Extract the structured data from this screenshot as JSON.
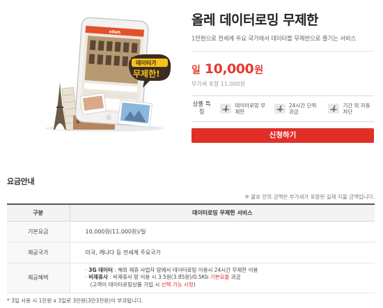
{
  "product": {
    "title": "올레 데이터로밍 무제한",
    "subtitle": "1만원으로 전세계 주요 국가에서 데이터를 무제한으로 즐기는 서비스",
    "price_prefix": "일",
    "price_amount": "10,000",
    "price_unit": "원",
    "vat_note": "부가세 포함 11,000원",
    "features_label": "상품 특징",
    "features": [
      {
        "icon": "airplane-icon",
        "label": "데이터로밍 무제한"
      },
      {
        "icon": "airplane-icon",
        "label": "24시간 단위 과금"
      },
      {
        "icon": "airplane-icon",
        "label": "기간 외 자동차단"
      }
    ],
    "apply_label": "신청하기"
  },
  "hero": {
    "bubble_line1": "데이터가",
    "bubble_line2": "무제한!",
    "phone_label": "olleh"
  },
  "fee_guide": {
    "title": "요금안내",
    "note": "※ 괄호 안의 금액은 부가세가 포함된 실제 지불 금액입니다.",
    "table": {
      "headers": [
        "구분",
        "데이터로밍 무제한 서비스"
      ],
      "rows": [
        {
          "label": "기본요금",
          "value": "10,000원(11,000원)/일"
        },
        {
          "label": "제공국가",
          "value": "미국, 캐나다 등 전세계 주요국가"
        }
      ],
      "benefit": {
        "label": "제공혜택",
        "line1_bold": "3G 데이터",
        "line1_text": " : 해외 제휴 사업자 망에서 데이터로밍 이용시 24시간 무제한 이용",
        "line2_bold": "비제휴사",
        "line2_text": " : 비제휴사 망 이용 시 3.5원(3.85원)/0.5Kb ",
        "line2_red": "기본요율",
        "line2_tail": " 과금",
        "line3_text": "(고객이 데이터로밍상품 가입 시 ",
        "line3_red": "선택 가능 사항",
        "line3_tail": ")"
      }
    },
    "footnote": "* 3일 사용 시 1만원 x 3일로 3만원(3만3천원)이 부과됩니다."
  },
  "colors": {
    "accent_red": "#e12e26",
    "price_red": "#e63a2e",
    "bubble_yellow": "#f6c21a"
  }
}
